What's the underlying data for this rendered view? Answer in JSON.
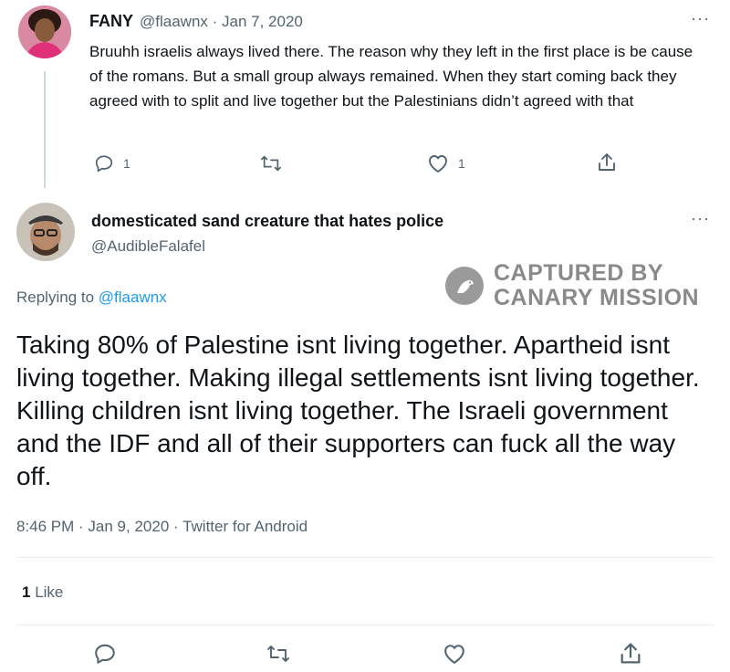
{
  "parent_tweet": {
    "name": "FANY",
    "handle_date": "@flaawnx · Jan 7, 2020",
    "text": "Bruuhh israelis always lived there. The reason why they left in the first place is be cause of the romans. But a small group always remained. When they start coming back they agreed with to split and live together but the Palestinians didn’t agreed with that",
    "reply_count": "1",
    "like_count": "1",
    "more": "···"
  },
  "main_tweet": {
    "name": "domesticated sand creature that hates police",
    "handle": "@AudibleFalafel",
    "more": "···",
    "replying_prefix": "Replying to ",
    "replying_handle": "@flaawnx",
    "text": "Taking 80% of Palestine isnt living together. Apartheid isnt living together. Making illegal settlements isnt living together. Killing children isnt living together. The Israeli government and the IDF and all of their supporters can fuck all the way off.",
    "meta": "8:46 PM · Jan 9, 2020 · Twitter for Android",
    "likes_count": "1",
    "likes_label": "Like"
  },
  "watermark": {
    "line1": "CAPTURED BY",
    "line2": "CANARY MISSION"
  },
  "colors": {
    "accent": "#1d9bf0",
    "muted": "#536471",
    "text": "#0f1419",
    "divider": "#e6ecf0"
  }
}
